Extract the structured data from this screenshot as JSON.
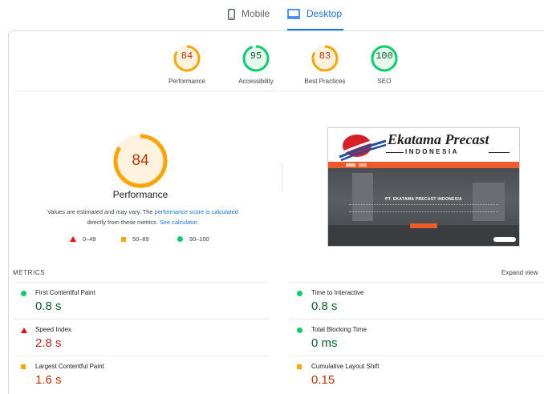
{
  "tabs": {
    "mobile_label": "Mobile",
    "desktop_label": "Desktop",
    "active": "desktop"
  },
  "summary": [
    {
      "score": "84",
      "label": "Performance",
      "status": "average"
    },
    {
      "score": "95",
      "label": "Accessibility",
      "status": "pass"
    },
    {
      "score": "83",
      "label": "Best Practices",
      "status": "average"
    },
    {
      "score": "100",
      "label": "SEO",
      "status": "pass"
    }
  ],
  "performance": {
    "score": "84",
    "title": "Performance",
    "desc_part1": "Values are estimated and may vary. The ",
    "desc_link1": "performance score is calculated",
    "desc_part2": " directly from these metrics. ",
    "desc_link2": "See calculator."
  },
  "legend": {
    "fail": "0–49",
    "average": "50–89",
    "pass": "90–100"
  },
  "screenshot": {
    "brand_line1": "Ekatama Precast",
    "brand_line2": "INDONESIA",
    "hero_title": "PT. EKATAMA PRECAST INDONESIA"
  },
  "metrics": {
    "heading": "METRICS",
    "expand_label": "Expand view",
    "items": [
      {
        "name": "First Contentful Paint",
        "value": "0.8 s",
        "status": "pass"
      },
      {
        "name": "Time to Interactive",
        "value": "0.8 s",
        "status": "pass"
      },
      {
        "name": "Speed Index",
        "value": "2.8 s",
        "status": "fail"
      },
      {
        "name": "Total Blocking Time",
        "value": "0 ms",
        "status": "pass"
      },
      {
        "name": "Largest Contentful Paint",
        "value": "1.6 s",
        "status": "average"
      },
      {
        "name": "Cumulative Layout Shift",
        "value": "0.15",
        "status": "average"
      }
    ]
  },
  "colors": {
    "pass": "#0cce6b",
    "average": "#ffa400",
    "fail": "#eb0f00",
    "link": "#1a73e8"
  }
}
